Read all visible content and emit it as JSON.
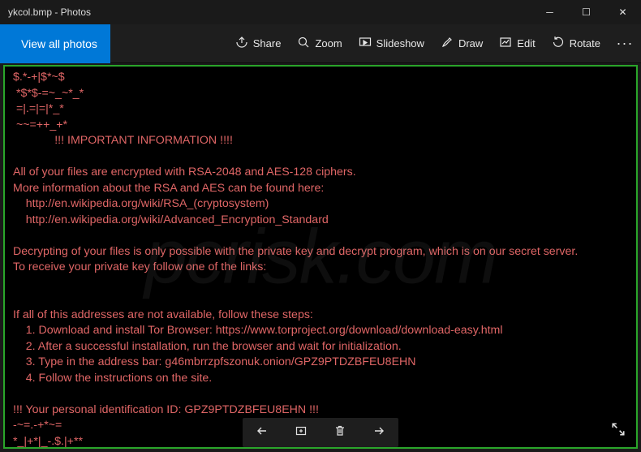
{
  "window": {
    "title": "ykcol.bmp - Photos",
    "controls": {
      "min": "─",
      "max": "☐",
      "close": "✕"
    }
  },
  "toolbar": {
    "view_all": "View all photos",
    "share": "Share",
    "zoom": "Zoom",
    "slideshow": "Slideshow",
    "draw": "Draw",
    "edit": "Edit",
    "rotate": "Rotate",
    "more": "···"
  },
  "watermark": "pcrisk.com",
  "ransom": {
    "line1": "$.*-+|$*~$",
    "line2": " *$*$-=~_~*_*",
    "line3": " =|.=|=|*_*",
    "line4": " ~~=++_+*",
    "line5": "             !!! IMPORTANT INFORMATION !!!!",
    "blank1": "",
    "line6": "All of your files are encrypted with RSA-2048 and AES-128 ciphers.",
    "line7": "More information about the RSA and AES can be found here:",
    "line8": "    http://en.wikipedia.org/wiki/RSA_(cryptosystem)",
    "line9": "    http://en.wikipedia.org/wiki/Advanced_Encryption_Standard",
    "blank2": "",
    "line10": "Decrypting of your files is only possible with the private key and decrypt program, which is on our secret server.",
    "line11": "To receive your private key follow one of the links:",
    "blank3": "",
    "blank4": "",
    "line12": "If all of this addresses are not available, follow these steps:",
    "line13": "    1. Download and install Tor Browser: https://www.torproject.org/download/download-easy.html",
    "line14": "    2. After a successful installation, run the browser and wait for initialization.",
    "line15": "    3. Type in the address bar: g46mbrrzpfszonuk.onion/GPZ9PTDZBFEU8EHN",
    "line16": "    4. Follow the instructions on the site.",
    "blank5": "",
    "line17": "!!! Your personal identification ID: GPZ9PTDZBFEU8EHN !!!",
    "line18": "-~=.-+*~=",
    "line19": "*_|+*|_-.$.|+**"
  },
  "colors": {
    "accent": "#0078d7",
    "ransom_text": "#e06666",
    "frame": "#2aa52a",
    "app_bg": "#1a1a1a"
  }
}
